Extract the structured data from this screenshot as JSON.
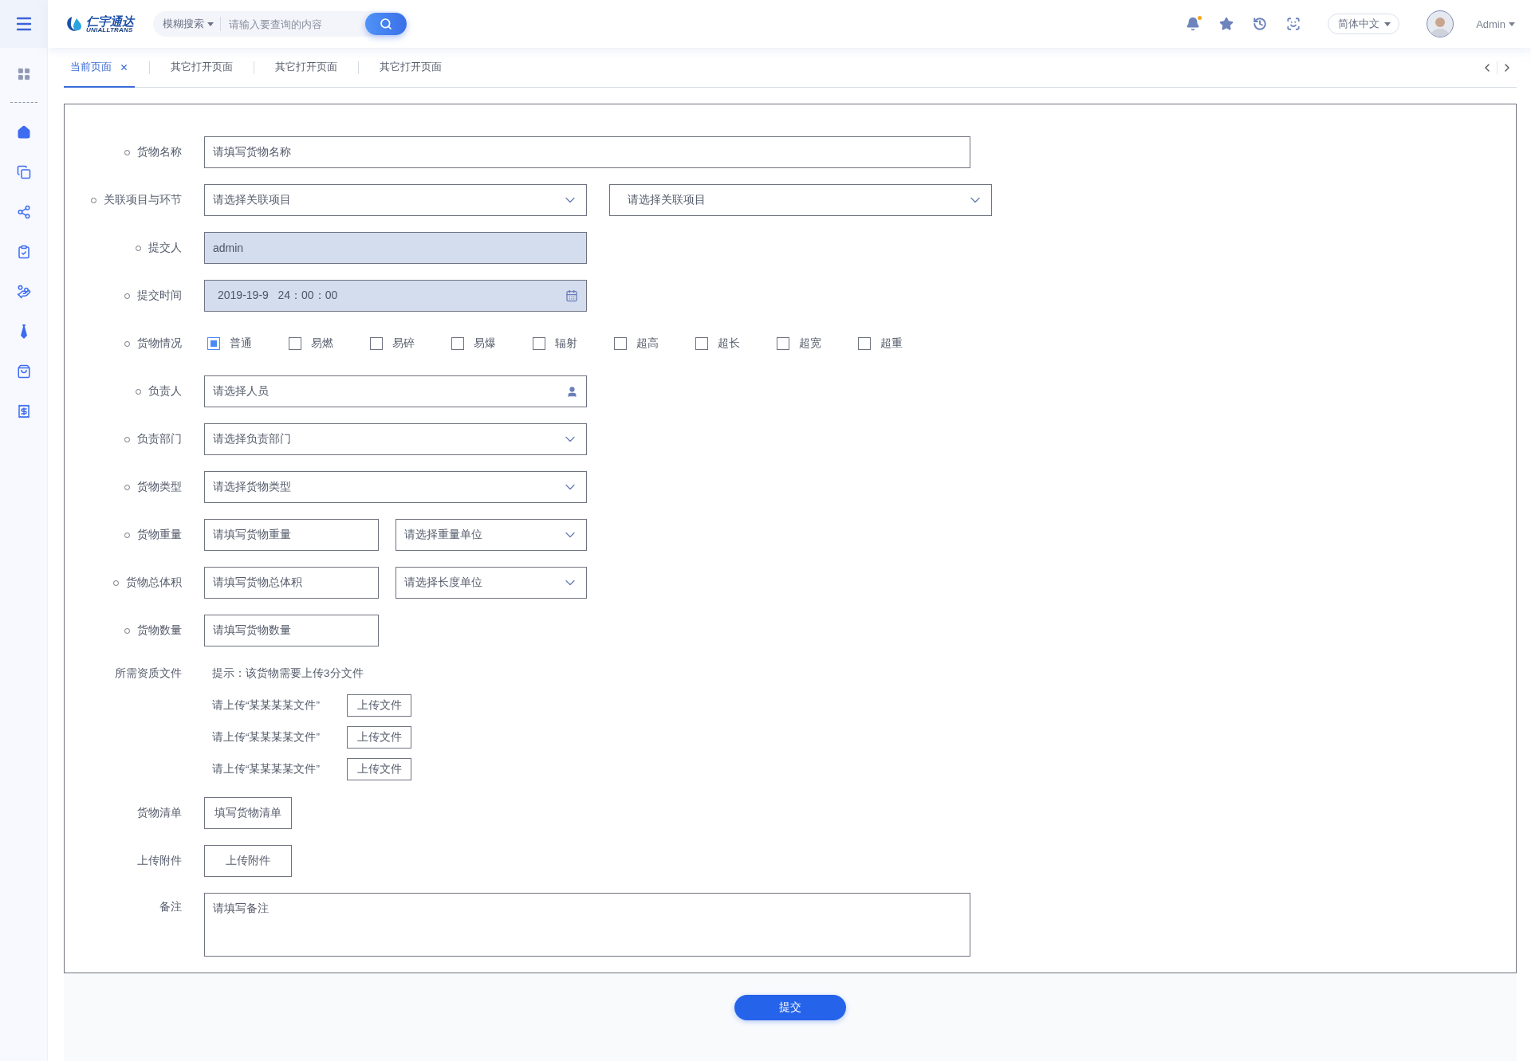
{
  "header": {
    "logo": {
      "name": "仁宇通达",
      "subtitle": "UNIALLTRANS"
    },
    "search": {
      "mode": "模糊搜索",
      "placeholder": "请输入要查询的内容"
    },
    "notifications": {
      "unread": true
    },
    "language": "简体中文",
    "user": "Admin"
  },
  "tabs": [
    {
      "label": "当前页面",
      "selected": true,
      "closable": true
    },
    {
      "label": "其它打开页面",
      "selected": false,
      "closable": false
    },
    {
      "label": "其它打开页面",
      "selected": false,
      "closable": false
    },
    {
      "label": "其它打开页面",
      "selected": false,
      "closable": false
    }
  ],
  "form": {
    "fields": [
      {
        "kind": "text",
        "label": "货物名称",
        "marked": true,
        "placeholder": "请填写货物名称"
      },
      {
        "kind": "select_pair",
        "label": "关联项目与环节",
        "marked": true,
        "selects": [
          {
            "placeholder": "请选择关联项目"
          },
          {
            "placeholder": "请选择关联项目"
          }
        ]
      },
      {
        "kind": "readonly",
        "label": "提交人",
        "marked": true,
        "value": "admin"
      },
      {
        "kind": "date",
        "label": "提交时间",
        "marked": true,
        "value": "2019-19-9   24：00：00"
      },
      {
        "kind": "checkboxes",
        "label": "货物情况",
        "marked": true,
        "options": [
          {
            "label": "普通",
            "checked": true
          },
          {
            "label": "易燃",
            "checked": false
          },
          {
            "label": "易碎",
            "checked": false
          },
          {
            "label": "易爆",
            "checked": false
          },
          {
            "label": "辐射",
            "checked": false
          },
          {
            "label": "超高",
            "checked": false
          },
          {
            "label": "超长",
            "checked": false
          },
          {
            "label": "超宽",
            "checked": false
          },
          {
            "label": "超重",
            "checked": false
          }
        ]
      },
      {
        "kind": "person",
        "label": "负责人",
        "marked": true,
        "placeholder": "请选择人员"
      },
      {
        "kind": "select",
        "label": "负责部门",
        "marked": true,
        "placeholder": "请选择负责部门"
      },
      {
        "kind": "select",
        "label": "货物类型",
        "marked": true,
        "placeholder": "请选择货物类型"
      },
      {
        "kind": "input_select",
        "label": "货物重量",
        "marked": true,
        "placeholder": "请填写货物重量",
        "select": "请选择重量单位"
      },
      {
        "kind": "input_select",
        "label": "货物总体积",
        "marked": true,
        "placeholder": "请填写货物总体积",
        "select": "请选择长度单位"
      },
      {
        "kind": "short_text",
        "label": "货物数量",
        "marked": true,
        "placeholder": "请填写货物数量"
      },
      {
        "kind": "files",
        "label": "所需资质文件",
        "marked": false,
        "hint": "提示：该货物需要上传3分文件",
        "items": [
          {
            "label": "请上传“某某某某文件”",
            "button": "上传文件"
          },
          {
            "label": "请上传“某某某某文件”",
            "button": "上传文件"
          },
          {
            "label": "请上传“某某某某文件”",
            "button": "上传文件"
          }
        ]
      },
      {
        "kind": "button",
        "label": "货物清单",
        "marked": false,
        "button": "填写货物清单"
      },
      {
        "kind": "button",
        "label": "上传附件",
        "marked": false,
        "button": "上传附件"
      },
      {
        "kind": "textarea",
        "label": "备注",
        "marked": false,
        "placeholder": "请填写备注"
      }
    ]
  },
  "submit": "提交"
}
